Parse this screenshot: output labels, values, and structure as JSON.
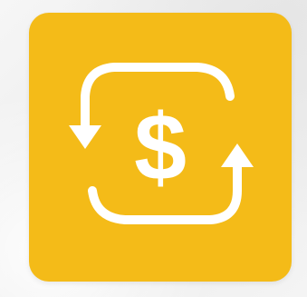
{
  "app_icon": {
    "name": "currency-exchange-app-icon",
    "icon": "dollar-exchange-cycle-icon",
    "symbol": "$",
    "background_color": "#f4bb18",
    "glyph_color": "#ffffff"
  }
}
